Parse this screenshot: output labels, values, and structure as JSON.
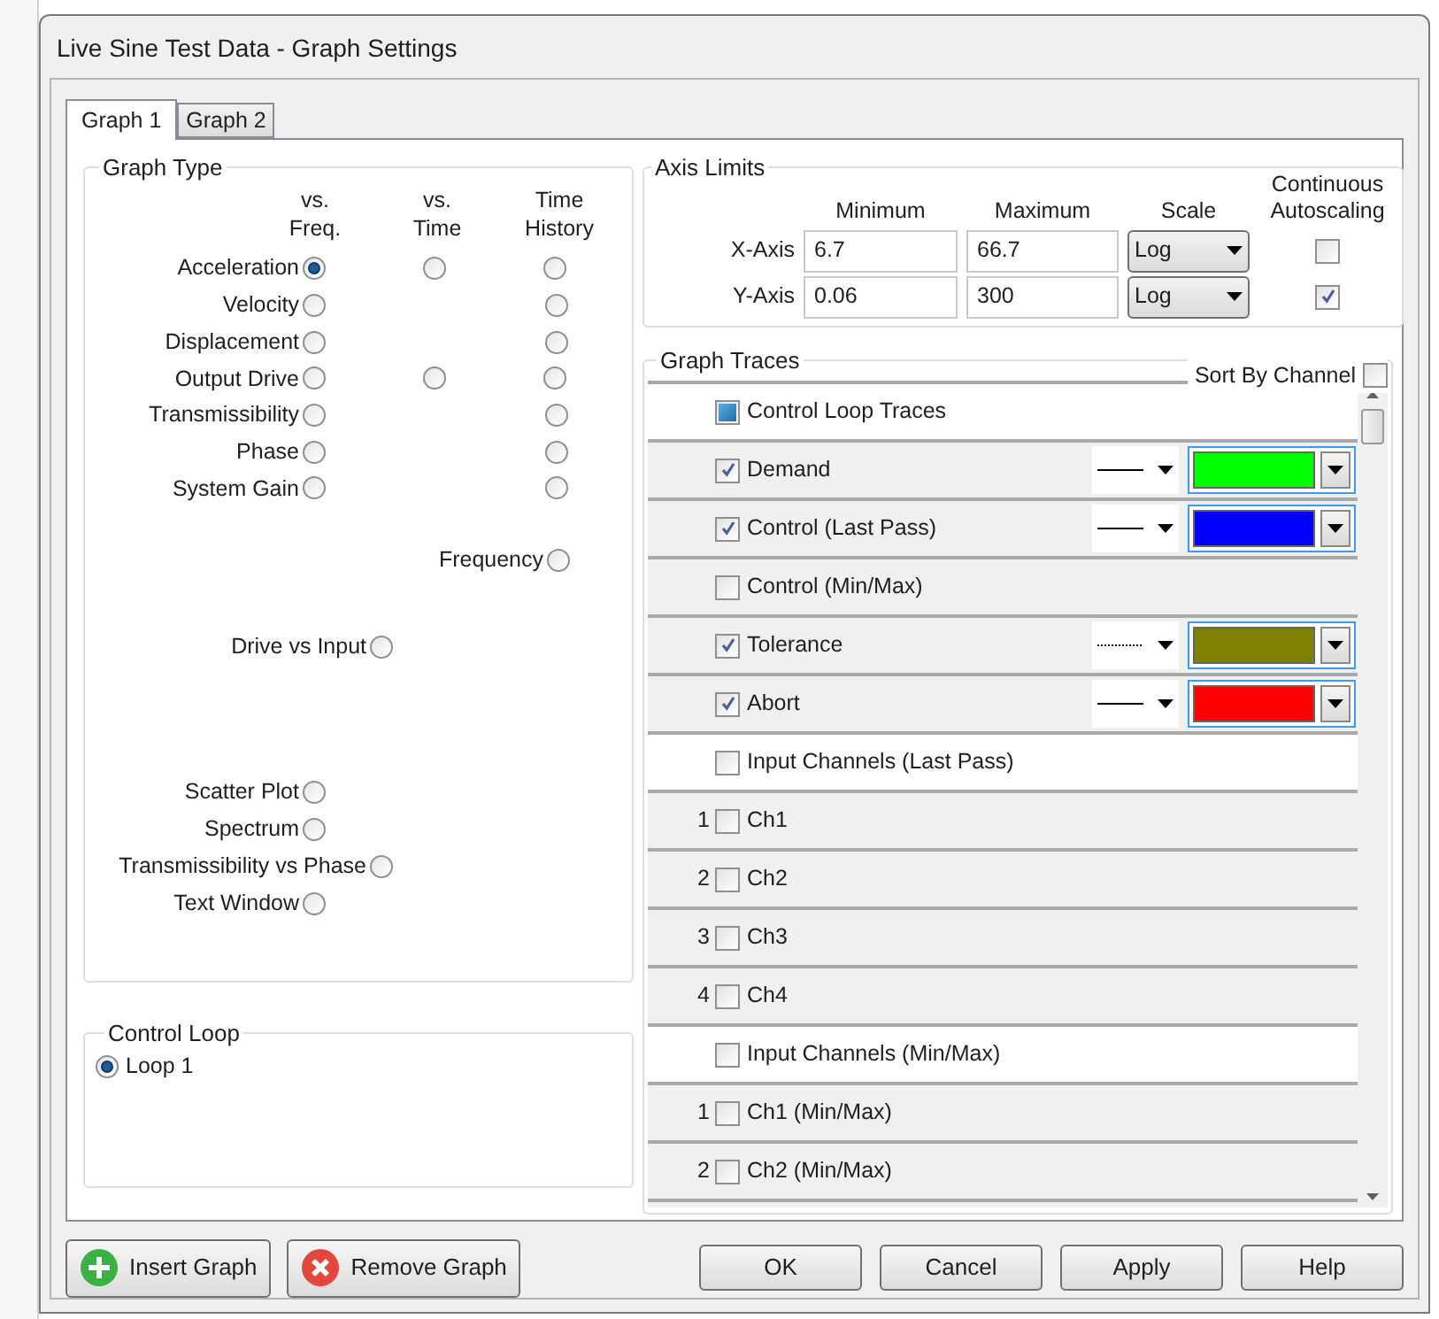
{
  "window": {
    "title": "Live Sine Test Data - Graph Settings"
  },
  "tabs": [
    {
      "label": "Graph 1",
      "selected": true
    },
    {
      "label": "Graph 2",
      "selected": false
    }
  ],
  "graph_type": {
    "title": "Graph Type",
    "columns": [
      {
        "lines": [
          "vs.",
          "Freq."
        ]
      },
      {
        "lines": [
          "vs.",
          "Time"
        ]
      },
      {
        "lines": [
          "Time",
          "History"
        ]
      }
    ],
    "rows": [
      {
        "label": "Acceleration",
        "options": [
          {
            "kind": "radio",
            "selected": true
          },
          {
            "kind": "radio",
            "selected": false
          },
          {
            "kind": "radio",
            "selected": false
          }
        ]
      },
      {
        "label": "Velocity",
        "options": [
          {
            "kind": "radio",
            "selected": false
          },
          {
            "kind": "none"
          },
          {
            "kind": "radio",
            "selected": false
          }
        ]
      },
      {
        "label": "Displacement",
        "options": [
          {
            "kind": "radio",
            "selected": false
          },
          {
            "kind": "none"
          },
          {
            "kind": "radio",
            "selected": false
          }
        ]
      },
      {
        "label": "Output Drive",
        "options": [
          {
            "kind": "radio",
            "selected": false
          },
          {
            "kind": "radio",
            "selected": false
          },
          {
            "kind": "radio",
            "selected": false
          }
        ]
      },
      {
        "label": "Transmissibility",
        "options": [
          {
            "kind": "radio",
            "selected": false
          },
          {
            "kind": "none"
          },
          {
            "kind": "radio",
            "selected": false
          }
        ]
      },
      {
        "label": "Phase",
        "options": [
          {
            "kind": "radio",
            "selected": false
          },
          {
            "kind": "none"
          },
          {
            "kind": "radio",
            "selected": false
          }
        ]
      },
      {
        "label": "System Gain",
        "options": [
          {
            "kind": "radio",
            "selected": false
          },
          {
            "kind": "none"
          },
          {
            "kind": "radio",
            "selected": false
          }
        ]
      }
    ],
    "single": [
      {
        "label": "Frequency",
        "selected": false
      },
      {
        "label": "Drive vs Input",
        "selected": false
      },
      {
        "label": "Scatter Plot",
        "selected": false
      },
      {
        "label": "Spectrum",
        "selected": false
      },
      {
        "label": "Transmissibility vs Phase",
        "selected": false
      },
      {
        "label": "Text Window",
        "selected": false
      }
    ]
  },
  "control_loop": {
    "title": "Control Loop",
    "options": [
      {
        "label": "Loop 1",
        "selected": true
      }
    ]
  },
  "axis_limits": {
    "title": "Axis Limits",
    "headers": [
      "Minimum",
      "Maximum",
      "Scale",
      "Continuous Autoscaling"
    ],
    "rows": [
      {
        "label": "X-Axis",
        "minimum": "6.7",
        "maximum": "66.7",
        "scale": "Log",
        "autoscaling": false
      },
      {
        "label": "Y-Axis",
        "minimum": "0.06",
        "maximum": "300",
        "scale": "Log",
        "autoscaling": true
      }
    ]
  },
  "traces": {
    "title": "Graph Traces",
    "sort_by_channel": {
      "label": "Sort By Channel",
      "checked": false
    },
    "items": [
      {
        "kind": "header",
        "label": "Control Loop Traces",
        "checked": false,
        "mixed": true
      },
      {
        "kind": "trace",
        "label": "Demand",
        "checked": true,
        "mixed": false,
        "dotted": false,
        "color": "#00ff00"
      },
      {
        "kind": "trace",
        "label": "Control (Last Pass)",
        "checked": true,
        "mixed": false,
        "dotted": false,
        "color": "#0000ff"
      },
      {
        "kind": "trace",
        "label": "Control (Min/Max)",
        "checked": false,
        "mixed": false
      },
      {
        "kind": "trace",
        "label": "Tolerance",
        "checked": true,
        "mixed": false,
        "dotted": true,
        "color": "#808000"
      },
      {
        "kind": "trace",
        "label": "Abort",
        "checked": true,
        "mixed": false,
        "dotted": false,
        "color": "#ff0000"
      },
      {
        "kind": "header",
        "label": "Input Channels (Last Pass)",
        "checked": false,
        "mixed": false
      },
      {
        "kind": "channel",
        "number": "1",
        "label": "Ch1",
        "checked": false,
        "mixed": false
      },
      {
        "kind": "channel",
        "number": "2",
        "label": "Ch2",
        "checked": false,
        "mixed": false
      },
      {
        "kind": "channel",
        "number": "3",
        "label": "Ch3",
        "checked": false,
        "mixed": false
      },
      {
        "kind": "channel",
        "number": "4",
        "label": "Ch4",
        "checked": false,
        "mixed": false
      },
      {
        "kind": "header",
        "label": "Input Channels (Min/Max)",
        "checked": false,
        "mixed": false
      },
      {
        "kind": "channel",
        "number": "1",
        "label": "Ch1 (Min/Max)",
        "checked": false,
        "mixed": false
      },
      {
        "kind": "channel",
        "number": "2",
        "label": "Ch2 (Min/Max)",
        "checked": false,
        "mixed": false
      }
    ]
  },
  "left_buttons": [
    {
      "label": "Insert Graph",
      "kind": "insert"
    },
    {
      "label": "Remove Graph",
      "kind": "remove"
    }
  ],
  "buttons": [
    "OK",
    "Cancel",
    "Apply",
    "Help"
  ]
}
